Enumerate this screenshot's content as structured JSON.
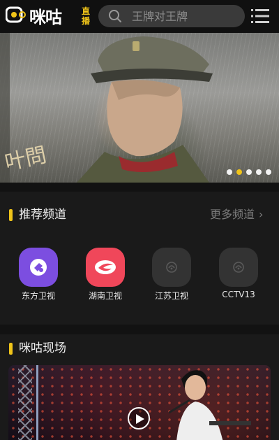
{
  "header": {
    "logo_text": "咪咕",
    "logo_sub": "直播",
    "search_placeholder": "王牌对王牌",
    "menu_icon": "menu-icon"
  },
  "banner": {
    "calligraphy": "叶問",
    "slide_count": 5,
    "active_slide": 2
  },
  "recommended": {
    "title": "推荐频道",
    "more_label": "更多频道",
    "channels": [
      {
        "label": "东方卫视",
        "icon": "dragon-tv-logo",
        "color": "#7c4ee0"
      },
      {
        "label": "湖南卫视",
        "icon": "hunan-tv-logo",
        "color": "#f0475a"
      },
      {
        "label": "江苏卫视",
        "icon": "placeholder-logo",
        "color": "#333333"
      },
      {
        "label": "CCTV13",
        "icon": "placeholder-logo",
        "color": "#333333"
      }
    ]
  },
  "live": {
    "title": "咪咕现场"
  },
  "colors": {
    "accent": "#f0c419",
    "background": "#121212",
    "panel": "#1a1a1a"
  }
}
